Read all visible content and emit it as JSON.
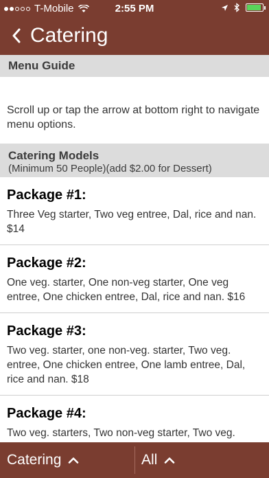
{
  "status": {
    "carrier": "T-Mobile",
    "time": "2:55 PM"
  },
  "nav": {
    "back_glyph": "‹",
    "title": "Catering"
  },
  "menu_guide": {
    "title": "Menu Guide",
    "text": "Scroll up or tap the arrow at bottom right to navigate menu options."
  },
  "catering_models": {
    "title": "Catering Models",
    "subtitle": "(Minimum 50 People)(add $2.00 for Dessert)"
  },
  "packages": [
    {
      "name": "Package #1:",
      "description": "Three Veg starter, Two veg entree, Dal, rice and nan. $14"
    },
    {
      "name": "Package #2:",
      "description": "One veg. starter, One non-veg starter, One veg entree, One chicken entree, Dal, rice and nan. $16"
    },
    {
      "name": "Package #3:",
      "description": "Two veg. starter, one non-veg. starter, Two veg. entree, One chicken entree, One lamb entree, Dal, rice and nan. $18"
    },
    {
      "name": "Package #4:",
      "description": "Two veg. starters, Two non-veg starter, Two veg."
    }
  ],
  "bottom_bar": {
    "left_label": "Catering",
    "right_label": "All",
    "caret_glyph": "^"
  },
  "colors": {
    "brand": "#7a3d30",
    "section_bg": "#dcdcdc",
    "battery": "#5ad35a"
  },
  "icons": [
    "wifi-icon",
    "location-icon",
    "bluetooth-icon",
    "battery-icon",
    "back-chevron-icon",
    "chevron-up-icon"
  ]
}
